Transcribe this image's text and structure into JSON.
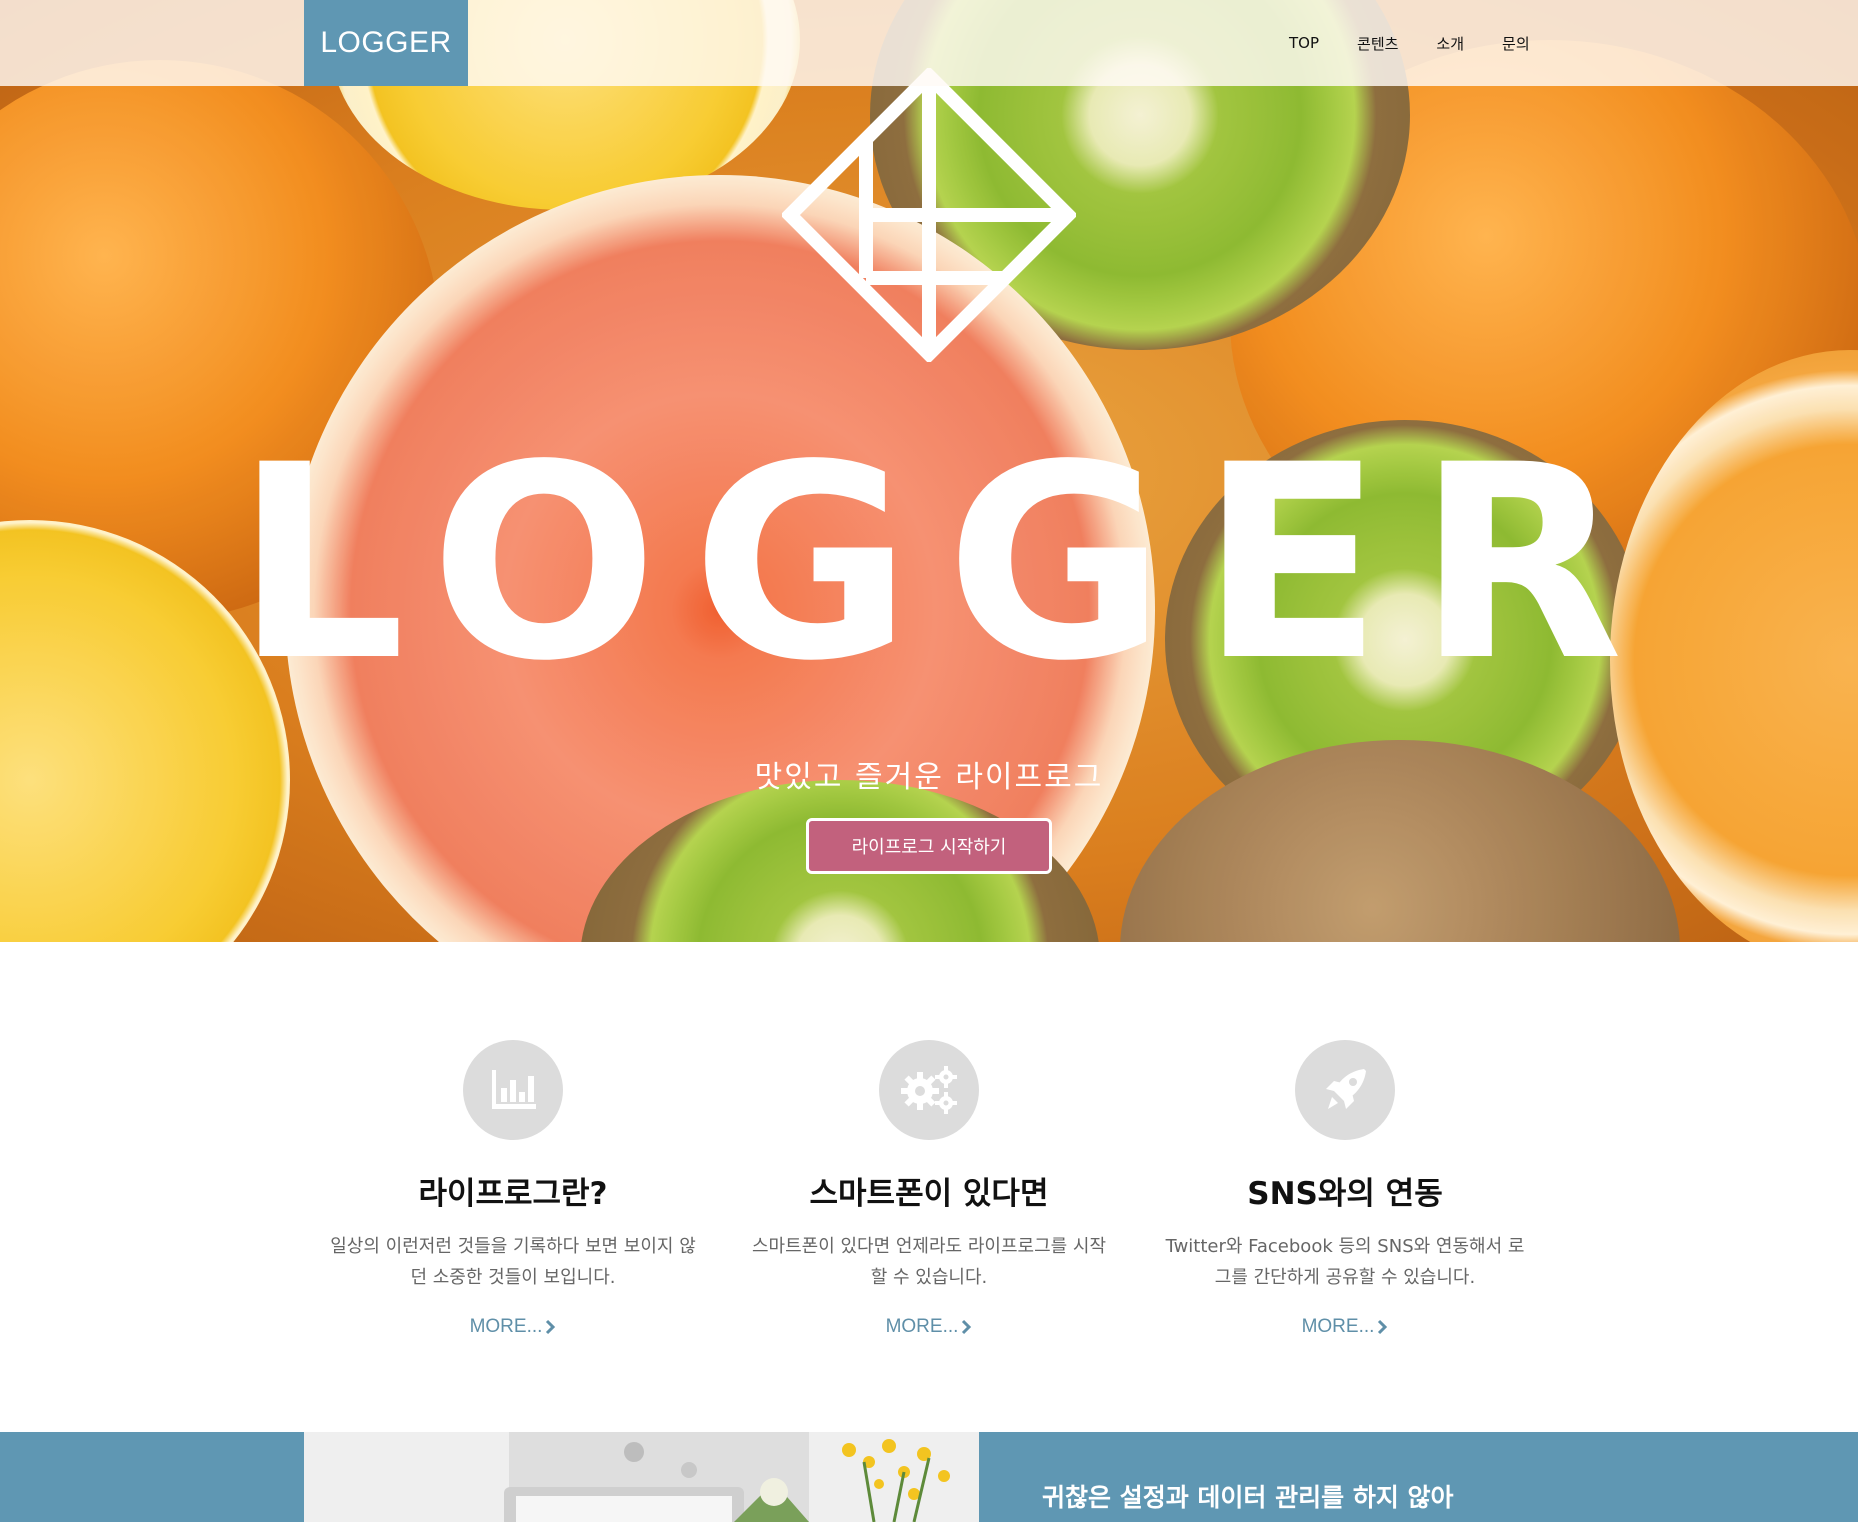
{
  "nav": {
    "brand": "LOGGER",
    "items": [
      {
        "label": "TOP"
      },
      {
        "label": "콘텐츠"
      },
      {
        "label": "소개"
      },
      {
        "label": "문의"
      }
    ]
  },
  "hero": {
    "title": "LOGGER",
    "subtitle": "맛있고 즐거운 라이프로그",
    "cta_label": "라이프로그 시작하기",
    "logo_icon": "diamond-logo-icon",
    "button_color": "#c2617d"
  },
  "features": [
    {
      "icon": "bar-chart-icon",
      "title": "라이프로그란?",
      "text": "일상의 이런저런 것들을 기록하다 보면 보이지 않던 소중한 것들이 보입니다.",
      "more": "MORE..."
    },
    {
      "icon": "gears-icon",
      "title": "스마트폰이 있다면",
      "text": "스마트폰이 있다면 언제라도 라이프로그를 시작할 수 있습니다.",
      "more": "MORE..."
    },
    {
      "icon": "rocket-icon",
      "title": "SNS와의 연동",
      "text": "Twitter와 Facebook 등의 SNS와 연동해서 로그를 간단하게 공유할 수 있습니다.",
      "more": "MORE..."
    }
  ],
  "band": {
    "heading": "귀찮은 설정과 데이터 관리를 하지 않아"
  },
  "colors": {
    "accent": "#5f97b3",
    "link": "#5f8fa8",
    "icon_bg": "#dcdcdc"
  }
}
